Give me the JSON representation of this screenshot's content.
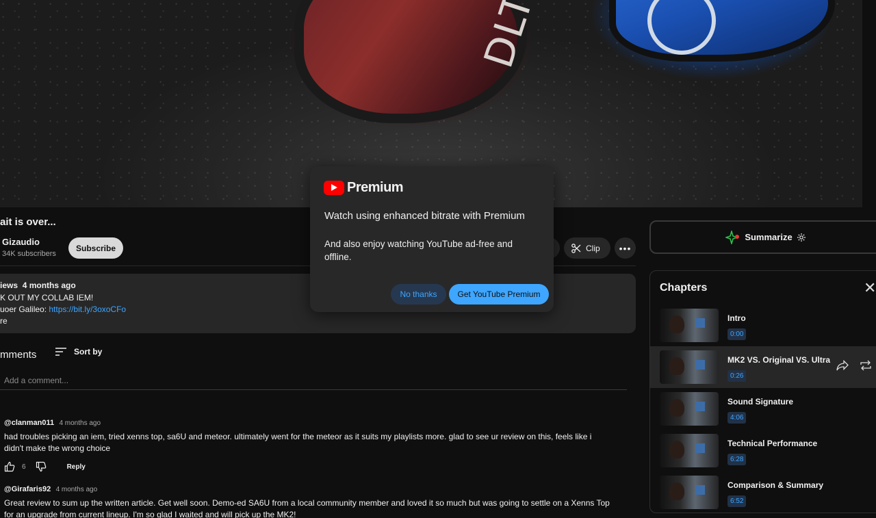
{
  "video": {
    "title": "ait is over...",
    "channel_name": "Gizaudio",
    "subscribers": "34K subscribers",
    "subscribe_label": "Subscribe",
    "clip_label": "Clip",
    "more_label": "•••",
    "iem_label": "DLT"
  },
  "description": {
    "views": "iews",
    "age": "4 months ago",
    "line2": "K OUT MY COLLAB IEM!",
    "line3_prefix": "uoer Galileo: ",
    "line3_link": "https://bit.ly/3oxoCFo",
    "line4": "re"
  },
  "comments_section": {
    "heading": "mments",
    "sort_label": "Sort by",
    "add_placeholder": "Add a comment...",
    "items": [
      {
        "user": "@clanman011",
        "time": "4 months ago",
        "text": "had troubles picking an iem, tried xenns top, sa6U and meteor. ultimately went for the meteor as it suits my playlists more. glad to see ur review on this, feels like i didn't make the wrong choice",
        "likes": "6",
        "reply_label": "Reply"
      },
      {
        "user": "@Girafaris92",
        "time": "4 months ago",
        "text": "Great review to sum up the written article. Get well soon. Demo-ed SA6U from a local community member and loved it so much but was going to settle on a Xenns Top for an upgrade from current lineup. I'm so glad I waited and will pick up the MK2!"
      }
    ]
  },
  "summarize": {
    "label": "Summarize"
  },
  "chapters": {
    "title": "Chapters",
    "items": [
      {
        "name": "Intro",
        "time": "0:00"
      },
      {
        "name": "MK2 VS. Original VS. Ultra",
        "time": "0:26"
      },
      {
        "name": "Sound Signature",
        "time": "4:06"
      },
      {
        "name": "Technical Performance",
        "time": "6:28"
      },
      {
        "name": "Comparison & Summary",
        "time": "6:52"
      }
    ]
  },
  "modal": {
    "brand": "Premium",
    "headline": "Watch using enhanced bitrate with Premium",
    "body": "And also enjoy watching YouTube ad-free and offline.",
    "no_thanks": "No thanks",
    "get_premium": "Get YouTube Premium"
  },
  "colors": {
    "accent_blue": "#3ea6ff",
    "youtube_red": "#ff0000",
    "background": "#0f0f0f"
  }
}
